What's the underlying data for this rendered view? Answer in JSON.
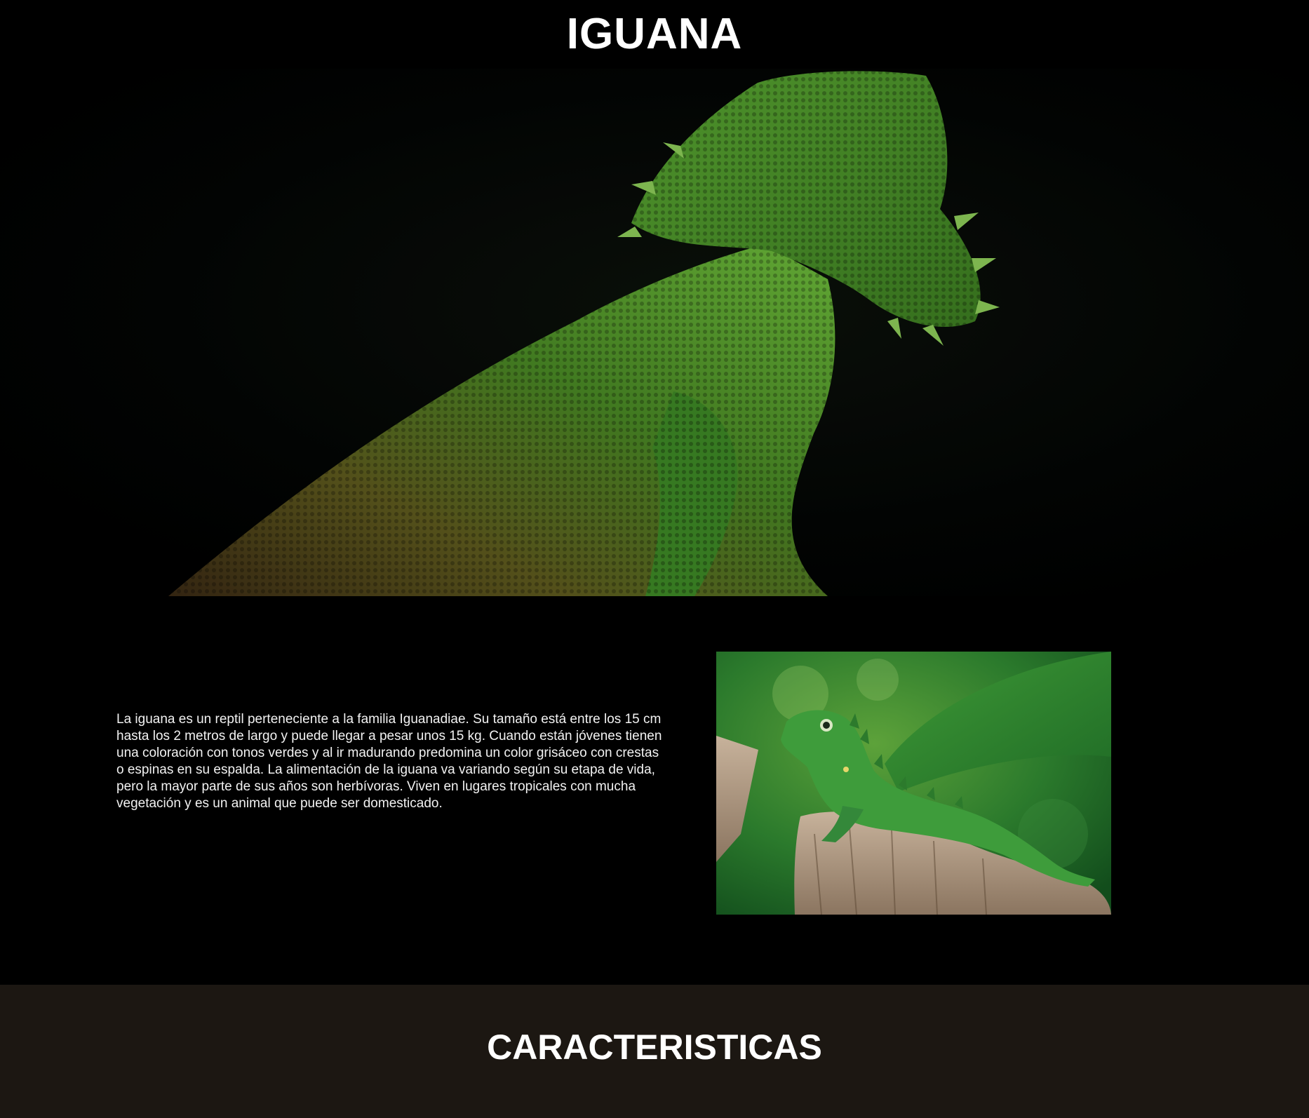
{
  "header": {
    "title": "IGUANA"
  },
  "hero": {
    "image": "bearded-dragon-hero-photo"
  },
  "intro": {
    "paragraph": "La iguana es un reptil perteneciente a la familia Iguanadiae. Su tamaño está entre los 15 cm hasta los 2 metros de largo y puede llegar a pesar unos 15 kg. Cuando están jóvenes tienen una coloración con tonos verdes y al ir madurando predomina un color grisáceo con crestas o espinas en su espalda. La alimentación de la iguana va variando según su etapa de vida, pero la mayor parte de sus años son herbívoras. Viven en lugares tropicales con mucha vegetación y es un animal que puede ser domesticado.",
    "image": "green-iguana-on-stump-photo"
  },
  "features": {
    "title": "CARACTERISTICAS"
  },
  "colors": {
    "page_background": "#000000",
    "features_background": "#1c1712",
    "lizard_green": "#4f9a2e"
  }
}
